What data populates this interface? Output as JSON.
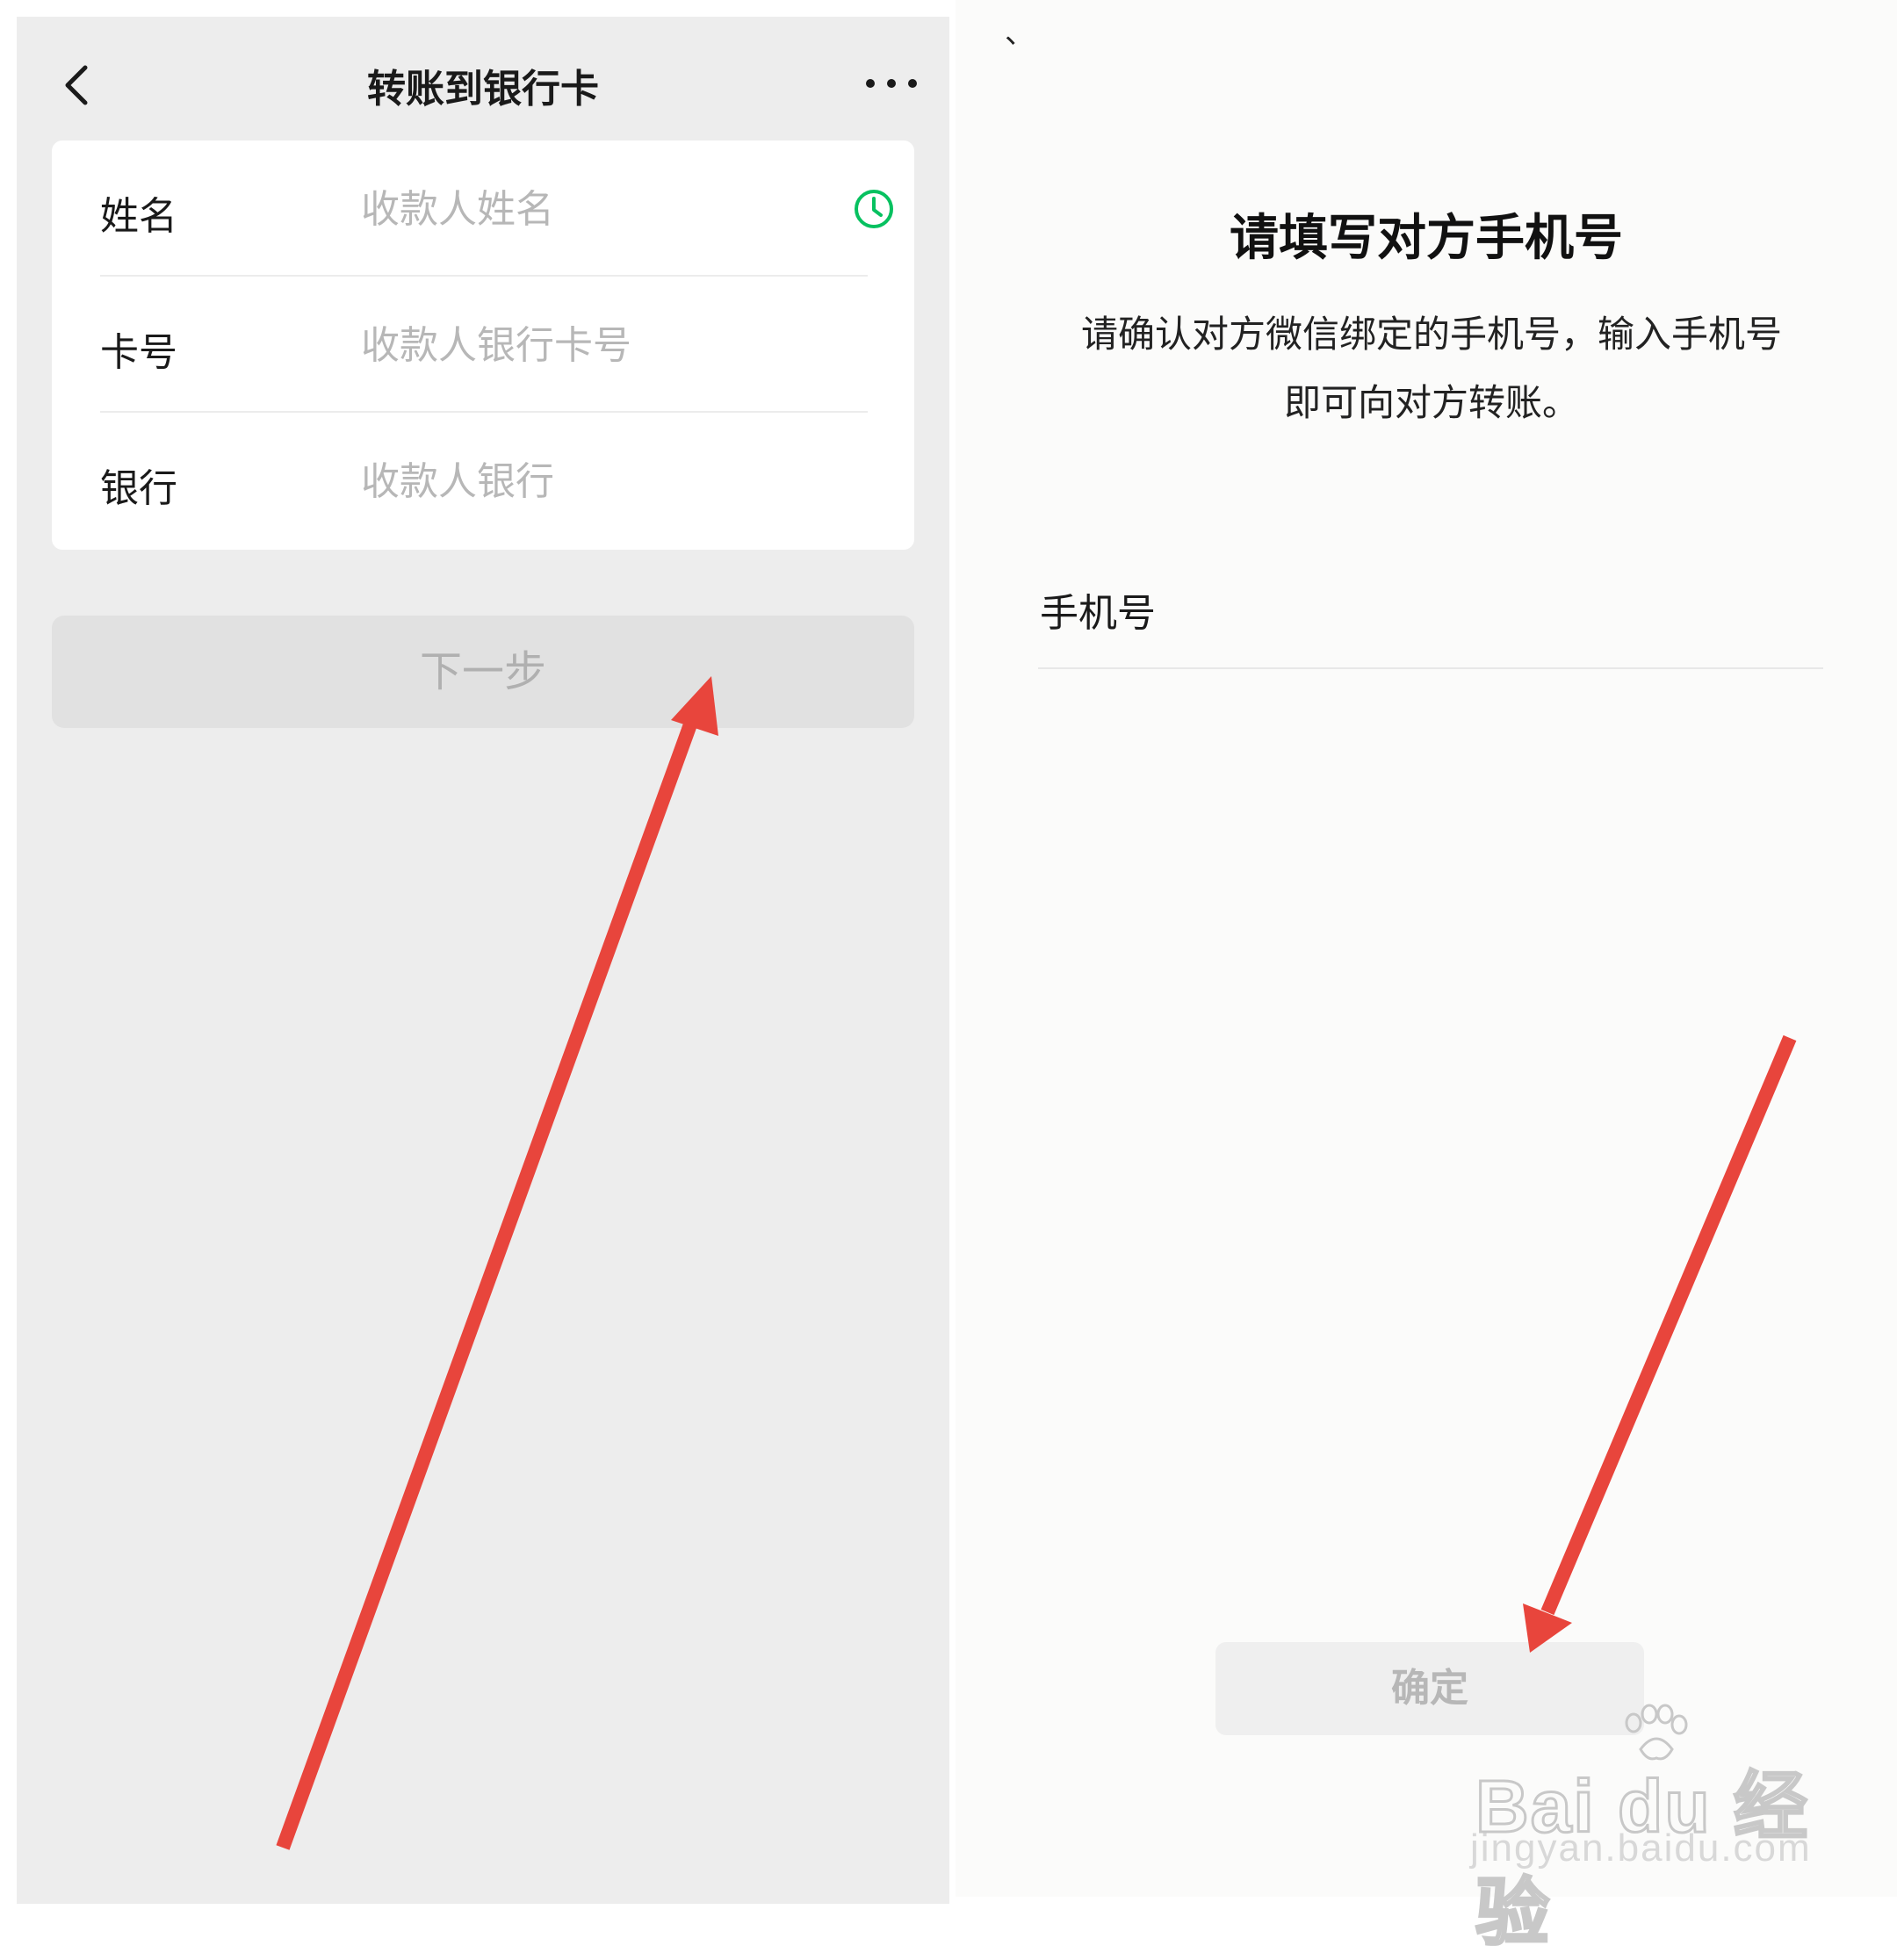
{
  "left_screen": {
    "nav": {
      "title": "转账到银行卡"
    },
    "form": {
      "rows": [
        {
          "label": "姓名",
          "placeholder": "收款人姓名"
        },
        {
          "label": "卡号",
          "placeholder": "收款人银行卡号"
        },
        {
          "label": "银行",
          "placeholder": "收款人银行"
        }
      ]
    },
    "next_button": "下一步"
  },
  "right_screen": {
    "corner_mark": "、",
    "title": "请填写对方手机号",
    "description_line1": "请确认对方微信绑定的手机号，输入手机号",
    "description_line2": "即可向对方转账。",
    "phone_label": "手机号",
    "confirm_button": "确定"
  },
  "watermark": {
    "main": "Bai du 经验",
    "sub": "jingyan.baidu.com"
  },
  "colors": {
    "accent_green": "#07c160",
    "annotation_red": "#e8453c"
  },
  "icons": [
    "back-chevron-icon",
    "more-dots-icon",
    "clock-icon",
    "paw-icon"
  ]
}
